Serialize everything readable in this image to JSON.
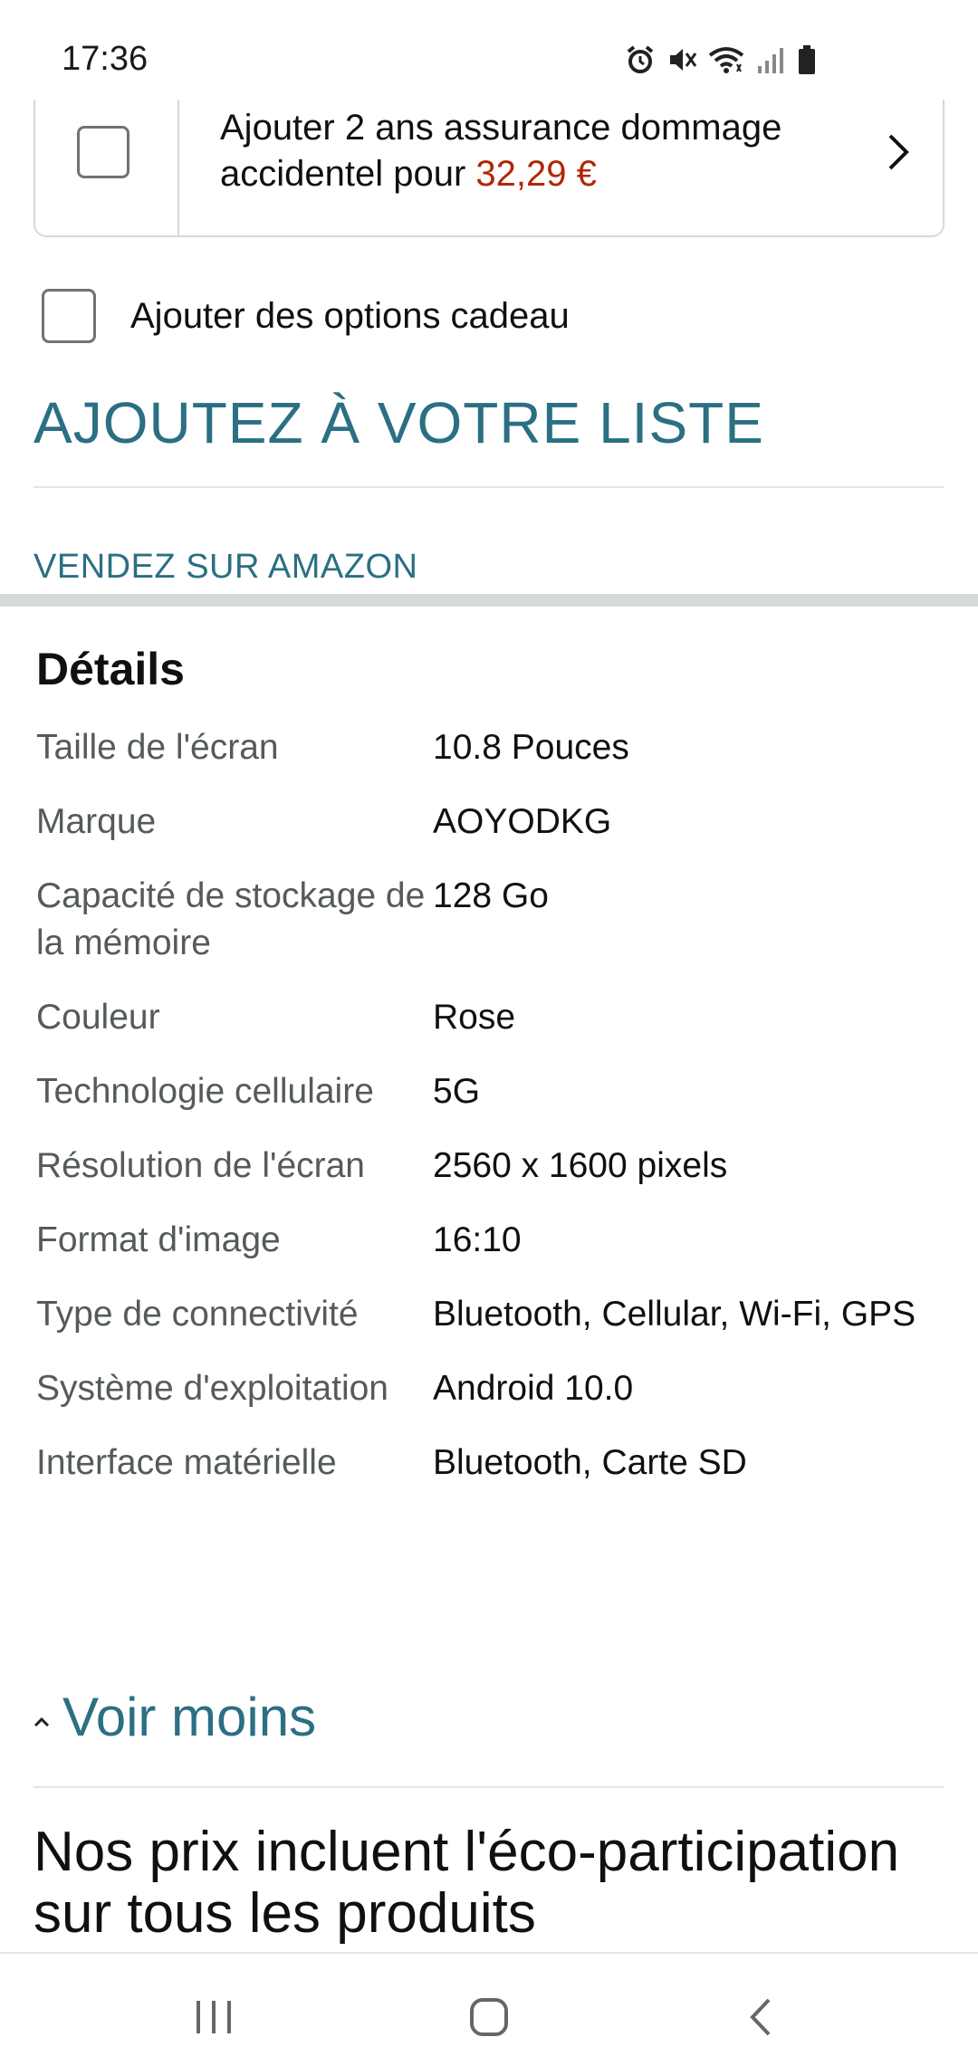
{
  "status_bar": {
    "time": "17:36",
    "icons": [
      "alarm-icon",
      "mute-icon",
      "wifi-icon",
      "signal-icon",
      "battery-icon"
    ]
  },
  "insurance": {
    "text": "Ajouter 2 ans assurance dommage accidentel pour ",
    "price": "32,29 €"
  },
  "gift": {
    "label": "Ajouter des options cadeau"
  },
  "add_to_list": "AJOUTEZ À VOTRE LISTE",
  "sell_on_amazon": "VENDEZ SUR AMAZON",
  "details": {
    "title": "Détails",
    "rows": [
      {
        "key": "Taille de l'écran",
        "value": "10.8 Pouces"
      },
      {
        "key": "Marque",
        "value": "AOYODKG"
      },
      {
        "key": "Capacité de stockage de la mémoire",
        "value": "128 Go"
      },
      {
        "key": "Couleur",
        "value": "Rose"
      },
      {
        "key": "Technologie cellulaire",
        "value": "5G"
      },
      {
        "key": "Résolution de l'écran",
        "value": "2560 x 1600 pixels"
      },
      {
        "key": "Format d'image",
        "value": "16:10"
      },
      {
        "key": "Type de connectivité",
        "value": "Bluetooth, Cellular, Wi-Fi, GPS"
      },
      {
        "key": "Système d'exploitation",
        "value": "Android 10.0"
      },
      {
        "key": "Interface matérielle",
        "value": "Bluetooth, Carte SD"
      }
    ]
  },
  "see_less": "Voir moins",
  "eco_heading": "Nos prix incluent l'éco-participation sur tous les produits",
  "colors": {
    "link": "#2b6f83",
    "price": "#b12704",
    "text": "#0f1111",
    "muted": "#555a5a"
  },
  "nav_bar": {
    "buttons": [
      "recent-apps-icon",
      "home-icon",
      "back-icon"
    ]
  }
}
